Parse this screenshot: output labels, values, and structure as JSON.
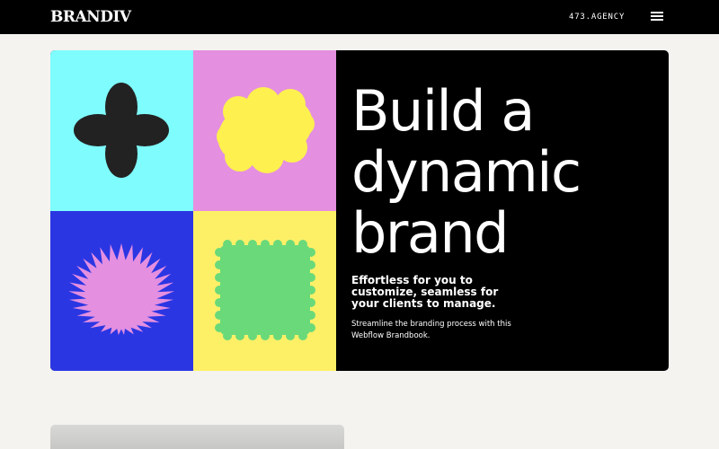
{
  "header": {
    "logo": "BRANDIV",
    "agency_label": "473.AGENCY",
    "menu_icon": "hamburger-menu-icon"
  },
  "hero": {
    "headline": "Build a dynamic brand",
    "subheadline": "Effortless for you to customize, seamless for your clients to manage.",
    "description": "Streamline the branding process with this Webflow Brandbook.",
    "tiles": [
      {
        "shape": "clover-icon",
        "background": "#7ffcfd",
        "shape_color": "#222222"
      },
      {
        "shape": "wavy-oval-icon",
        "background": "#e48fe0",
        "shape_color": "#fdf04f"
      },
      {
        "shape": "starburst-icon",
        "background": "#2b36e3",
        "shape_color": "#e48fe0"
      },
      {
        "shape": "wavy-square-icon",
        "background": "#fdf067",
        "shape_color": "#6ad97a"
      }
    ]
  },
  "colors": {
    "topbar": "#000000",
    "page_background": "#f4f3f0",
    "hero_text_panel": "#000000"
  }
}
